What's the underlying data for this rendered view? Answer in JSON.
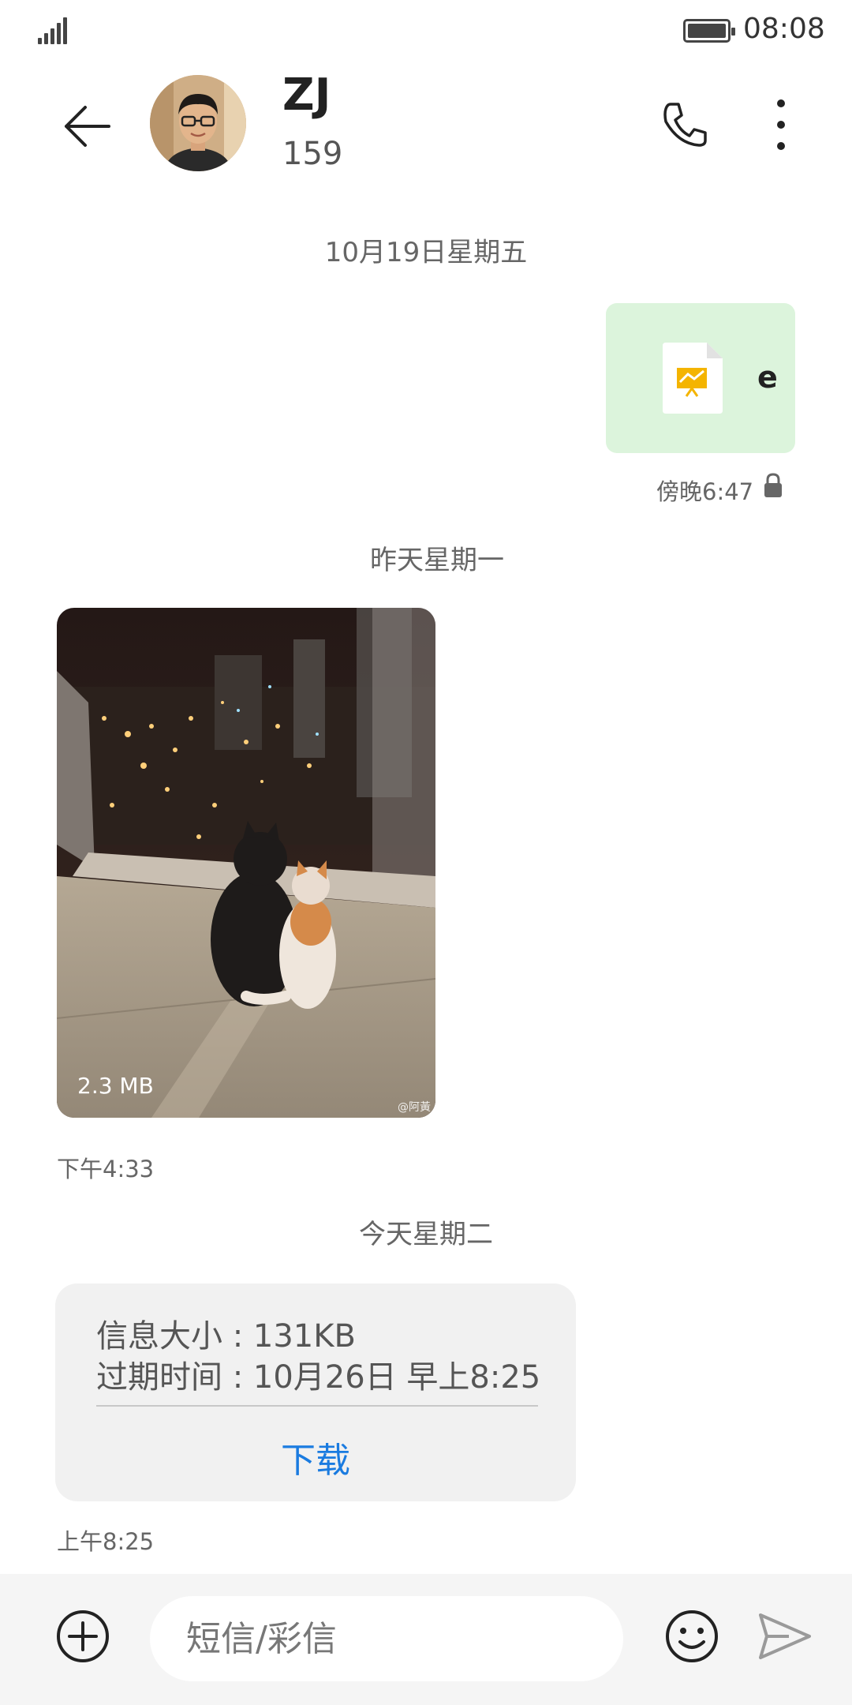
{
  "status_bar": {
    "time": "08:08"
  },
  "header": {
    "name": "ZJ",
    "number": "159"
  },
  "separators": {
    "first": "10月19日星期五",
    "second": "昨天星期一",
    "third": "今天星期二"
  },
  "sent_message": {
    "text": "e",
    "time": "傍晚6:47"
  },
  "received_image": {
    "size": "2.3 MB",
    "watermark": "@阿黃",
    "time": "下午4:33"
  },
  "mms": {
    "size_line": "信息大小 : 131KB",
    "expiry_line": "过期时间 :  10月26日 早上8:25",
    "download_label": "下载",
    "time": "上午8:25"
  },
  "composer": {
    "placeholder": "短信/彩信"
  },
  "colors": {
    "sent_bubble": "#dcf4dc",
    "download_link": "#1a7be0",
    "bubble_gray": "#f1f1f1"
  }
}
